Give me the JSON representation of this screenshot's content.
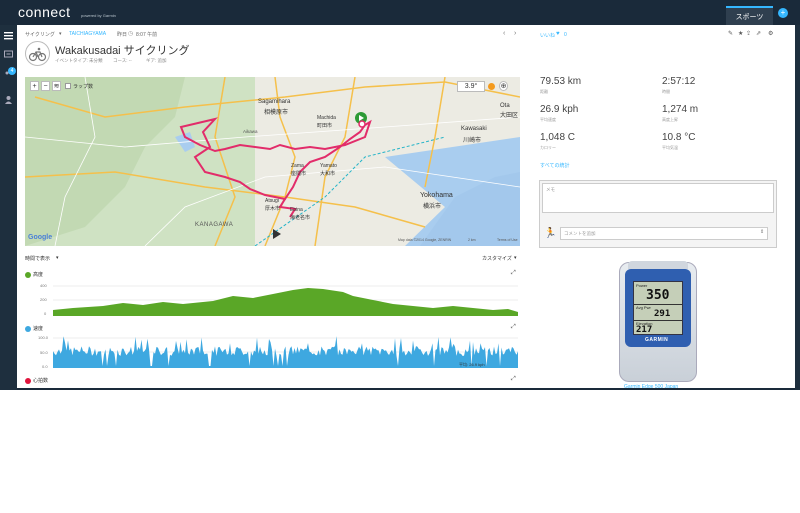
{
  "app": {
    "logo": "connect",
    "logo_sub": "powered by Garmin",
    "sports_tab": "スポーツ",
    "notification_count": "4"
  },
  "breadcrumb": {
    "type": "サイクリング",
    "location": "TAICHIAGYAMA",
    "when": "昨日",
    "time": "8:07 午前"
  },
  "activity": {
    "title": "Wakakusadai サイクリング",
    "meta1": "イベントタイプ: 未分類",
    "meta2": "コース: --",
    "meta3": "ギア: 追加"
  },
  "social": {
    "likes": "いいね",
    "like_count": "0"
  },
  "map": {
    "layer_label": "ラップ数",
    "temperature": "3.9°",
    "places": [
      "Sagamihara",
      "相模原市",
      "Machida",
      "町田市",
      "Ota",
      "大田区",
      "Kawasaki",
      "川崎市",
      "Zama",
      "座間市",
      "Yamato",
      "大和市",
      "Yokohama",
      "横浜市",
      "Atsugi",
      "厚木市",
      "Ebina",
      "海老名市",
      "KANAGAWA",
      "Aikawa"
    ],
    "attribution": "Map data ©2014 Google, ZENRIN",
    "scale": "2 km",
    "terms": "Terms of Use",
    "google": "Google"
  },
  "charts": {
    "view_by": "時間で表示",
    "customize": "カスタマイズ",
    "elevation": {
      "label": "高度",
      "ticks": [
        "400",
        "200",
        "0"
      ],
      "color": "#5aa727"
    },
    "speed": {
      "label": "速度",
      "ticks": [
        "100.0",
        "50.0",
        "0.0"
      ],
      "avg": "平均: 26.9 kph",
      "color": "#3ea8e0"
    },
    "heart": {
      "label": "心拍数",
      "color": "#e0143c"
    }
  },
  "stats": [
    {
      "value": "79.53 km",
      "label": "距離"
    },
    {
      "value": "2:57:12",
      "label": "時間"
    },
    {
      "value": "26.9 kph",
      "label": "平均速度"
    },
    {
      "value": "1,274 m",
      "label": "高度上昇"
    },
    {
      "value": "1,048 C",
      "label": "カロリー"
    },
    {
      "value": "10.8 °C",
      "label": "平均気温"
    }
  ],
  "all_stats_link": "すべての統計",
  "notes_placeholder": "メモ",
  "comment_placeholder": "コメントを追加",
  "device": {
    "brand": "GARMIN",
    "field1_label": "Power",
    "field1": "350",
    "field2_label": "Avg Pwr",
    "field2": "291",
    "field3_label": "Elevation",
    "field3": "217",
    "caption": "Garmin Edge 500 Japan"
  }
}
